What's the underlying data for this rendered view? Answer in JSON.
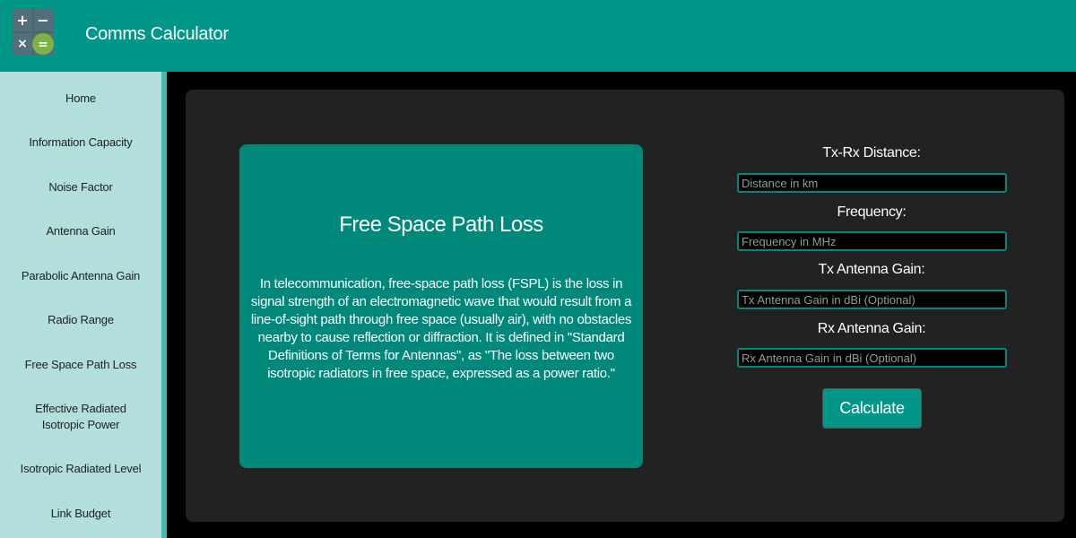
{
  "header": {
    "title": "Comms Calculator",
    "logo_icon": "calculator-icon"
  },
  "colors": {
    "header_bg": "#009688",
    "sidebar_bg": "#b2dfdb",
    "accent": "#009688",
    "card_bg": "#00897b",
    "panel_bg": "#222222"
  },
  "sidebar": {
    "items": [
      {
        "label": "Home"
      },
      {
        "label": "Information Capacity"
      },
      {
        "label": "Noise Factor"
      },
      {
        "label": "Antenna Gain"
      },
      {
        "label": "Parabolic Antenna Gain"
      },
      {
        "label": "Radio Range"
      },
      {
        "label": "Free Space Path Loss"
      },
      {
        "label": "Effective Radiated Isotropic Power"
      },
      {
        "label": "Isotropic Radiated Level"
      },
      {
        "label": "Link Budget"
      }
    ]
  },
  "info": {
    "title": "Free Space Path Loss",
    "description": "In telecommunication, free-space path loss (FSPL) is the loss in signal strength of an electromagnetic wave that would result from a line-of-sight path through free space (usually air), with no obstacles nearby to cause reflection or diffraction. It is defined in \"Standard Definitions of Terms for Antennas\", as \"The loss between two isotropic radiators in free space, expressed as a power ratio.\""
  },
  "form": {
    "distance": {
      "label": "Tx-Rx Distance:",
      "placeholder": "Distance in km",
      "value": ""
    },
    "frequency": {
      "label": "Frequency:",
      "placeholder": "Frequency in MHz",
      "value": ""
    },
    "tx_gain": {
      "label": "Tx Antenna Gain:",
      "placeholder": "Tx Antenna Gain in dBi (Optional)",
      "value": ""
    },
    "rx_gain": {
      "label": "Rx Antenna Gain:",
      "placeholder": "Rx Antenna Gain in dBi (Optional)",
      "value": ""
    },
    "calculate_label": "Calculate"
  }
}
